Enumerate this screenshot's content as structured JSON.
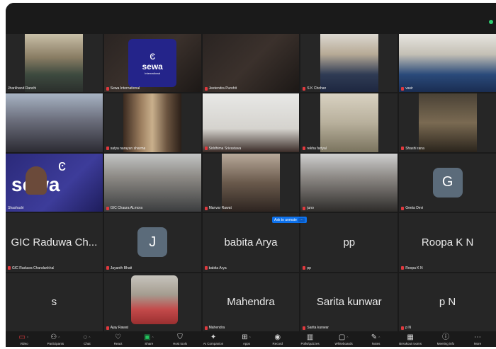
{
  "meeting": {
    "unmute_chip": "Ask to unmute"
  },
  "tiles": [
    {
      "id": "t1",
      "caption": "Jharkhand Ranchi"
    },
    {
      "id": "t2",
      "caption": "Sewa International",
      "logo_word": "sewa",
      "logo_sub": "International"
    },
    {
      "id": "t3",
      "caption": "Jeetendra Purohit"
    },
    {
      "id": "t4",
      "caption": "S K Chohan"
    },
    {
      "id": "t5",
      "caption": "vasir"
    },
    {
      "id": "t6",
      "caption": ""
    },
    {
      "id": "t7",
      "caption": "satya narayan sharma"
    },
    {
      "id": "t8",
      "caption": "Siddhima Srivastava"
    },
    {
      "id": "t9",
      "caption": "rekha fartyal"
    },
    {
      "id": "t10",
      "caption": "Shashi rana"
    },
    {
      "id": "t11",
      "caption": "Shashadri",
      "sewa_word": "sewa"
    },
    {
      "id": "t12",
      "caption": "GIC Chaura ALmora"
    },
    {
      "id": "t13",
      "caption": "Manvar Rawat"
    },
    {
      "id": "t14",
      "caption": "juno"
    },
    {
      "id": "t15",
      "caption": "Geeta Devi",
      "avatar": "G"
    },
    {
      "id": "t16",
      "caption": "GIC Raduwa Chandankhal",
      "big_name": "GIC Raduwa Ch..."
    },
    {
      "id": "t17",
      "caption": "Jayanth Bhatt",
      "avatar": "J"
    },
    {
      "id": "t18",
      "caption": "babita Arya",
      "big_name": "babita Arya"
    },
    {
      "id": "t19",
      "caption": "pp",
      "big_name": "pp"
    },
    {
      "id": "t20",
      "caption": "Roopa K N",
      "big_name": "Roopa K N"
    },
    {
      "id": "t21",
      "caption": "",
      "big_name": "s"
    },
    {
      "id": "t22",
      "caption": "Ajay Rawat"
    },
    {
      "id": "t23",
      "caption": "Mahendra",
      "big_name": "Mahendra"
    },
    {
      "id": "t24",
      "caption": "Sarita kunwar",
      "big_name": "Sarita kunwar"
    },
    {
      "id": "t25",
      "caption": "p N",
      "big_name": "p N"
    }
  ],
  "toolbar": {
    "items": [
      {
        "label": "Video",
        "icon": "video-off-icon",
        "glyph": "▭"
      },
      {
        "label": "Participants",
        "icon": "participants-icon",
        "glyph": "👥"
      },
      {
        "label": "Chat",
        "icon": "chat-icon",
        "glyph": "💬"
      },
      {
        "label": "React",
        "icon": "react-icon",
        "glyph": "♡"
      },
      {
        "label": "Share",
        "icon": "share-icon",
        "glyph": "▣"
      },
      {
        "label": "Host tools",
        "icon": "host-tools-icon",
        "glyph": "⛉"
      },
      {
        "label": "AI Companion",
        "icon": "ai-companion-icon",
        "glyph": "✦"
      },
      {
        "label": "Apps",
        "icon": "apps-icon",
        "glyph": "⊞"
      },
      {
        "label": "Record",
        "icon": "record-icon",
        "glyph": "◉"
      },
      {
        "label": "Polls/quizzes",
        "icon": "polls-icon",
        "glyph": "▥"
      },
      {
        "label": "Whiteboards",
        "icon": "whiteboards-icon",
        "glyph": "▢"
      },
      {
        "label": "Notes",
        "icon": "notes-icon",
        "glyph": "✎"
      },
      {
        "label": "Breakout rooms",
        "icon": "breakout-rooms-icon",
        "glyph": "▦"
      },
      {
        "label": "Meeting info",
        "icon": "meeting-info-icon",
        "glyph": "ⓘ"
      },
      {
        "label": "More",
        "icon": "more-icon",
        "glyph": "⋯"
      }
    ]
  },
  "colors": {
    "background": "#1a1a1a",
    "tile": "#262626",
    "mic_muted": "#e0393e",
    "accent_blue": "#0e72ed",
    "active_green": "#2ecc71"
  }
}
